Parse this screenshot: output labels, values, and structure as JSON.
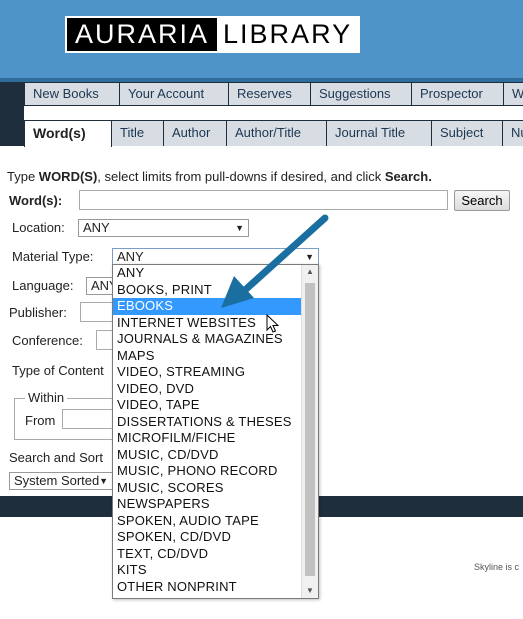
{
  "header": {
    "logo_left": "AURARIA",
    "logo_right": "LIBRARY"
  },
  "nav_top": {
    "tabs": [
      "New Books",
      "Your Account",
      "Reserves",
      "Suggestions",
      "Prospector",
      "W"
    ]
  },
  "nav_search": {
    "tabs": [
      "Word(s)",
      "Title",
      "Author",
      "Author/Title",
      "Journal Title",
      "Subject",
      "Nu"
    ],
    "active": "Word(s)"
  },
  "form": {
    "intro_pre": "Type ",
    "intro_bold1": "WORD(S)",
    "intro_mid": ", select limits from pull-downs if desired, and click ",
    "intro_bold2": "Search.",
    "words_label": "Word(s):",
    "search_button": "Search",
    "location_label": "Location:",
    "location_value": "ANY",
    "material_label": "Material Type:",
    "material_value": "ANY",
    "language_label": "Language:",
    "language_value": "ANY",
    "publisher_label": "Publisher:",
    "conference_label": "Conference:",
    "content_label": "Type of Content",
    "within_legend": "Within",
    "from_label": "From",
    "sort_label": "Search and Sort",
    "sort_value": "System Sorted"
  },
  "dropdown": {
    "options": [
      "ANY",
      "BOOKS, PRINT",
      "EBOOKS",
      "INTERNET WEBSITES",
      "JOURNALS & MAGAZINES",
      "MAPS",
      "VIDEO, STREAMING",
      "VIDEO, DVD",
      "VIDEO, TAPE",
      "DISSERTATIONS & THESES",
      "MICROFILM/FICHE",
      "MUSIC, CD/DVD",
      "MUSIC, PHONO RECORD",
      "MUSIC, SCORES",
      "NEWSPAPERS",
      "SPOKEN, AUDIO TAPE",
      "SPOKEN, CD/DVD",
      "TEXT, CD/DVD",
      "KITS",
      "OTHER NONPRINT"
    ],
    "highlighted": "EBOOKS"
  },
  "footer": {
    "skyline": "Skyline is c"
  },
  "colors": {
    "header": "#4f94c9",
    "navy": "#1f2e3c",
    "tab": "#d8dde3",
    "highlight": "#3399ff",
    "arrow": "#1a6fa0"
  }
}
